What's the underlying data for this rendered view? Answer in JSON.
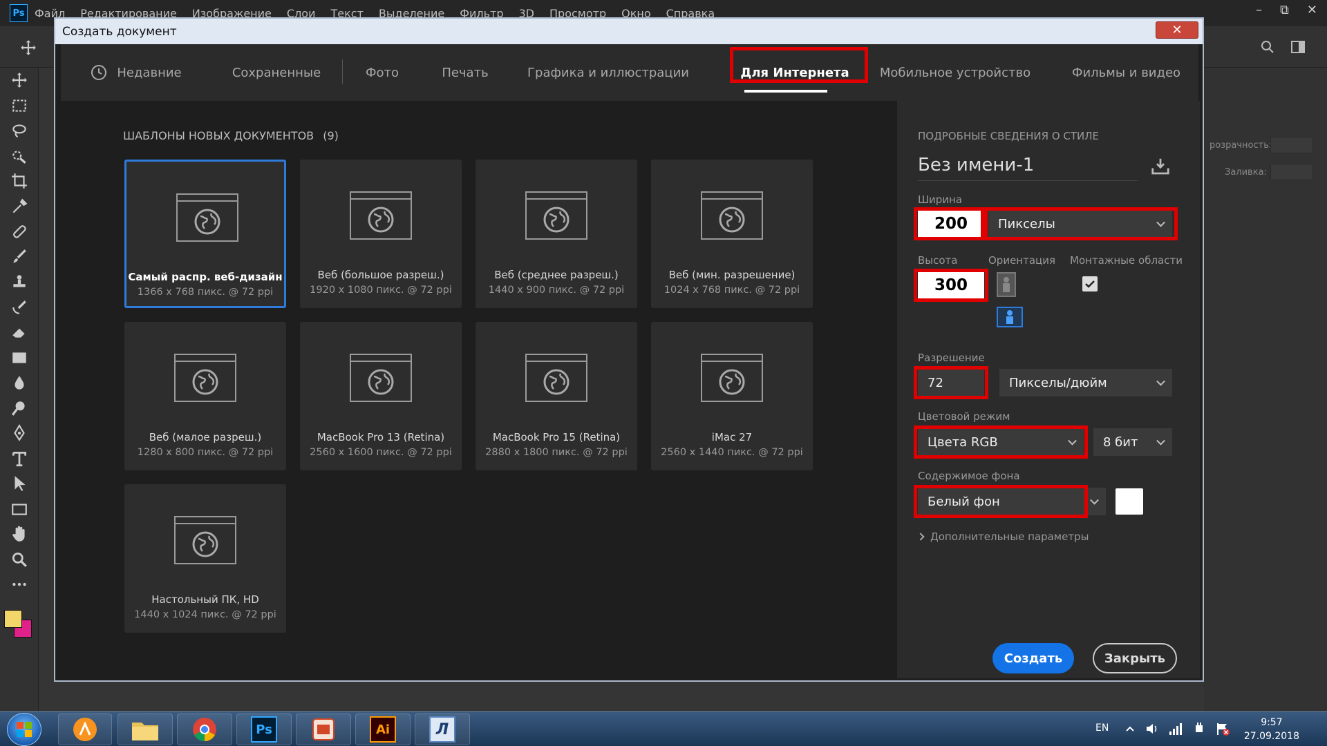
{
  "app": {
    "logo_text": "Ps",
    "menu": [
      "Файл",
      "Редактирование",
      "Изображение",
      "Слои",
      "Текст",
      "Выделение",
      "Фильтр",
      "3D",
      "Просмотр",
      "Окно",
      "Справка"
    ],
    "right_panel_labels": {
      "opacity": "розрачность:",
      "fill": "Заливка:"
    }
  },
  "dialog": {
    "title": "Создать документ",
    "close_symbol": "✕",
    "tabs": [
      "Недавние",
      "Сохраненные",
      "Фото",
      "Печать",
      "Графика и иллюстрации",
      "Для Интернета",
      "Мобильное устройство",
      "Фильмы и видео"
    ],
    "active_tab": "Для Интернета",
    "templates_heading": "ШАБЛОНЫ НОВЫХ ДОКУМЕНТОВ",
    "templates_count": "(9)",
    "templates": [
      {
        "name": "Самый распр. веб-дизайн",
        "dims": "1366 x 768 пикс. @ 72 ppi"
      },
      {
        "name": "Веб (большое разреш.)",
        "dims": "1920 x 1080 пикс. @ 72 ppi"
      },
      {
        "name": "Веб (среднее разреш.)",
        "dims": "1440 x 900 пикс. @ 72 ppi"
      },
      {
        "name": "Веб (мин. разрешение)",
        "dims": "1024 x 768 пикс. @ 72 ppi"
      },
      {
        "name": "Веб (малое разреш.)",
        "dims": "1280 x 800 пикс. @ 72 ppi"
      },
      {
        "name": "MacBook Pro 13 (Retina)",
        "dims": "2560 x 1600 пикс. @ 72 ppi"
      },
      {
        "name": "MacBook Pro 15 (Retina)",
        "dims": "2880 x 1800 пикс. @ 72 ppi"
      },
      {
        "name": "iMac 27",
        "dims": "2560 x 1440 пикс. @ 72 ppi"
      },
      {
        "name": "Настольный ПК, HD",
        "dims": "1440 x 1024 пикс. @ 72 ppi"
      }
    ],
    "details": {
      "heading": "ПОДРОБНЫЕ СВЕДЕНИЯ О СТИЛЕ",
      "doc_name": "Без имени-1",
      "width_label": "Ширина",
      "width_value": "200",
      "width_unit": "Пикселы",
      "height_label": "Высота",
      "height_value": "300",
      "orientation_label": "Ориентация",
      "artboards_label": "Монтажные области",
      "artboards_checked": true,
      "resolution_label": "Разрешение",
      "resolution_value": "72",
      "resolution_unit": "Пикселы/дюйм",
      "color_mode_label": "Цветовой режим",
      "color_mode_value": "Цвета RGB",
      "bit_depth": "8 бит",
      "background_label": "Содержимое фона",
      "background_value": "Белый фон",
      "background_color": "#ffffff",
      "advanced_label": "Дополнительные параметры",
      "create_label": "Создать",
      "close_label": "Закрыть"
    }
  },
  "taskbar": {
    "apps": [
      "start-orb",
      "avast",
      "file-explorer",
      "chrome",
      "photoshop",
      "pdf-reader",
      "illustrator",
      "abbyy-lingvo"
    ],
    "illustrator_text": "Ai",
    "photoshop_text": "Ps",
    "lingvo_text": "Л",
    "language": "EN",
    "time": "9:57",
    "date": "27.09.2018"
  },
  "colors": {
    "accent": "#1473e6",
    "highlight_red": "#e00000",
    "selected_border": "#2f7bdb",
    "foreground_swatch": "#f3d66a",
    "background_swatch": "#e0218a"
  }
}
